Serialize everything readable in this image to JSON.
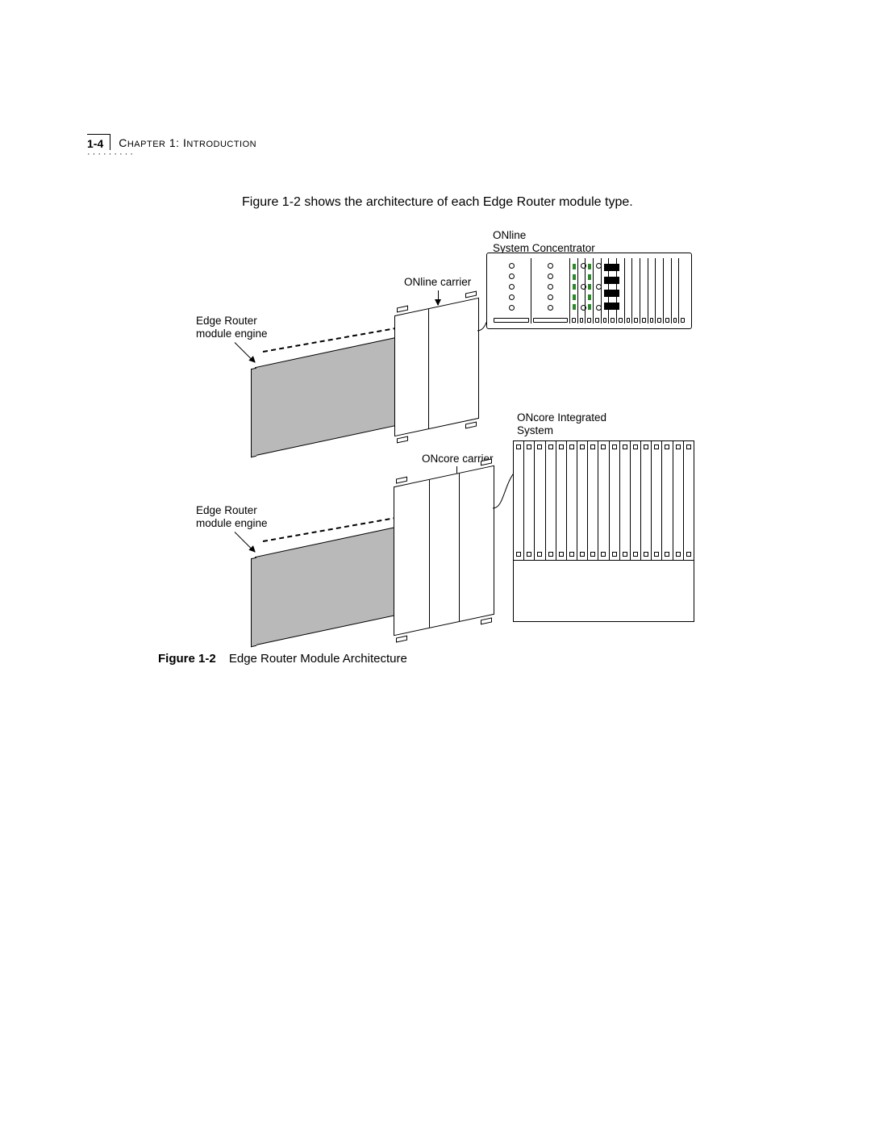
{
  "header": {
    "page_number": "1-4",
    "chapter_prefix": "C",
    "chapter_word_rest": "HAPTER",
    "chapter_num": "1:",
    "chapter_title_first": "I",
    "chapter_title_rest": "NTRODUCTION"
  },
  "intro_paragraph": "Figure 1-2 shows the architecture of each Edge Router module type.",
  "labels": {
    "online_system": "ONline\nSystem Concentrator",
    "online_carrier": "ONline carrier",
    "edge_router_1": "Edge Router\nmodule engine",
    "oncore_system": "ONcore Integrated\nSystem",
    "oncore_carrier": "ONcore carrier",
    "edge_router_2": "Edge Router\nmodule engine"
  },
  "caption": {
    "figure_ref": "Figure 1-2",
    "figure_title": "Edge Router Module Architecture"
  }
}
